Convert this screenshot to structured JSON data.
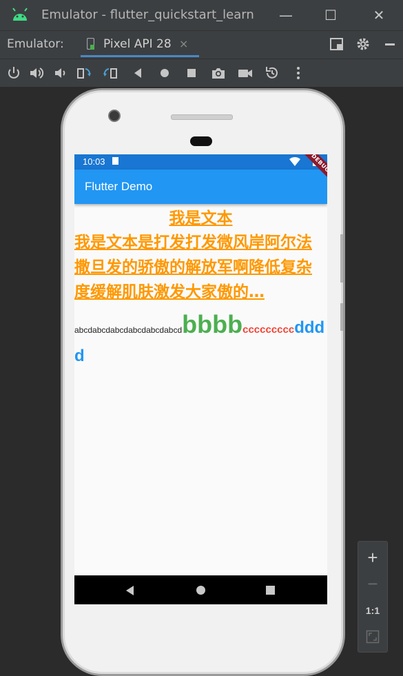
{
  "window": {
    "title": "Emulator - flutter_quickstart_learn",
    "minimize": "—",
    "maximize": "☐",
    "close": "✕"
  },
  "tabbar": {
    "prefix": "Emulator:",
    "tab_label": "Pixel API 28",
    "tab_close": "×"
  },
  "toolbar": {
    "icons": [
      "power-icon",
      "volume-up-icon",
      "volume-down-icon",
      "rotate-left-icon",
      "rotate-right-icon",
      "back-icon",
      "home-icon",
      "overview-icon",
      "screenshot-icon",
      "screenrecord-icon",
      "snapshot-icon",
      "more-icon"
    ]
  },
  "device": {
    "status_time": "10:03",
    "debug_banner": "DEBUG",
    "appbar_title": "Flutter Demo",
    "text1": "我是文本",
    "text2": "我是文本是打发打发微风岸阿尔法撒旦发的骄傲的解放军啊降低复杂度缓解肌肤激发大家傲的…",
    "rich_small": "abcdabcdabcdabcdabcdabcd",
    "rich_big": "bbbb",
    "rich_red": "ccccccccc",
    "rich_blue": "dddd"
  },
  "zoom_panel": {
    "zoom_in": "+",
    "zoom_out": "−",
    "one_to_one": "1:1",
    "fit": "⛶"
  },
  "colors": {
    "orange": "#ff9800",
    "green": "#4caf50",
    "red": "#f44336",
    "blue": "#2196f3",
    "statusbar": "#1976d2"
  }
}
